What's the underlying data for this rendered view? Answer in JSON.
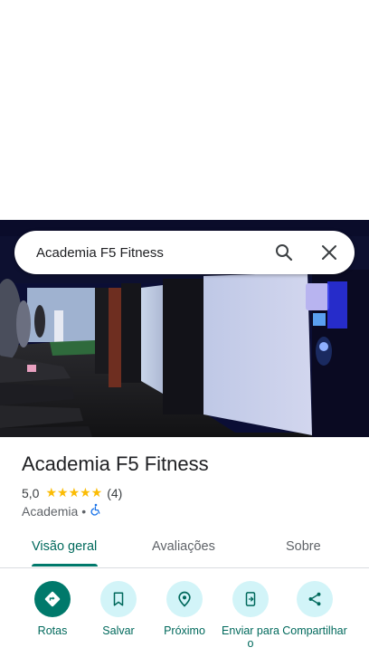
{
  "search": {
    "query": "Academia F5 Fitness"
  },
  "place": {
    "title": "Academia F5 Fitness",
    "rating": "5,0",
    "stars": "★★★★★",
    "review_count": "(4)",
    "category": "Academia",
    "separator": "•",
    "wheelchair_icon": "♿"
  },
  "tabs": [
    {
      "label": "Visão geral"
    },
    {
      "label": "Avaliações"
    },
    {
      "label": "Sobre"
    }
  ],
  "actions": [
    {
      "label": "Rotas",
      "icon": "directions-icon"
    },
    {
      "label": "Salvar",
      "icon": "bookmark-icon"
    },
    {
      "label": "Próximo",
      "icon": "nearby-icon"
    },
    {
      "label": "Enviar para o",
      "icon": "send-to-phone-icon"
    },
    {
      "label": "Compartilhar",
      "icon": "share-icon"
    }
  ],
  "colors": {
    "accent": "#00796b",
    "accent_text": "#00695c",
    "action_bg": "#d2f4f8",
    "star": "#fbbc04"
  }
}
